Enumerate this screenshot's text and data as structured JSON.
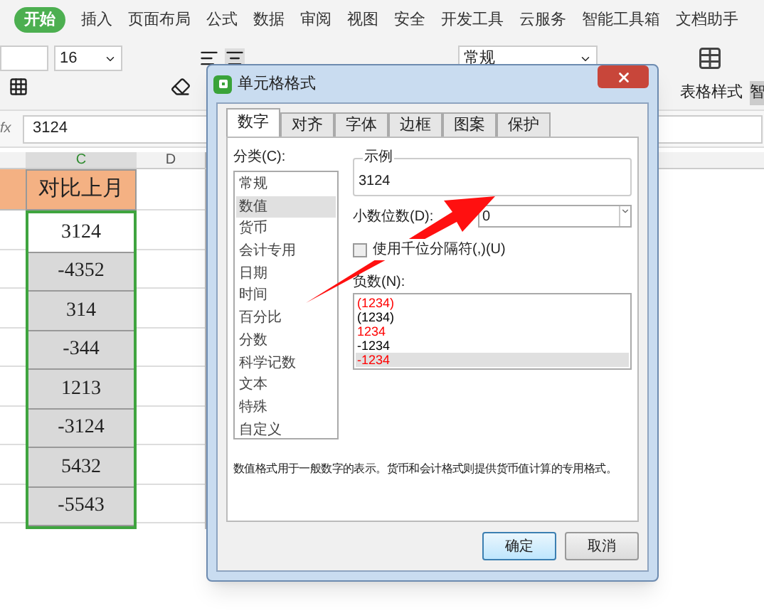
{
  "menu_tabs": [
    {
      "label": "开始",
      "selected": true
    },
    {
      "label": "插入",
      "selected": false
    },
    {
      "label": "页面布局",
      "selected": false
    },
    {
      "label": "公式",
      "selected": false
    },
    {
      "label": "数据",
      "selected": false
    },
    {
      "label": "审阅",
      "selected": false
    },
    {
      "label": "视图",
      "selected": false
    },
    {
      "label": "安全",
      "selected": false
    },
    {
      "label": "开发工具",
      "selected": false
    },
    {
      "label": "云服务",
      "selected": false
    },
    {
      "label": "智能工具箱",
      "selected": false
    },
    {
      "label": "文档助手",
      "selected": false
    }
  ],
  "toolbar": {
    "font_size": "16",
    "number_format": "常规",
    "table_style": "表格样式",
    "cut_label": "智"
  },
  "formula_bar": {
    "fx": "fx",
    "value": "3124"
  },
  "sheet": {
    "columns": [
      {
        "label": "C",
        "selected": true
      },
      {
        "label": "D",
        "selected": false
      }
    ],
    "header": "对比上月",
    "cells": [
      {
        "value": "3124",
        "active": true
      },
      {
        "value": "-4352",
        "active": false
      },
      {
        "value": "314",
        "active": false
      },
      {
        "value": "-344",
        "active": false
      },
      {
        "value": "1213",
        "active": false
      },
      {
        "value": "-3124",
        "active": false
      },
      {
        "value": "5432",
        "active": false
      },
      {
        "value": "-5543",
        "active": false
      }
    ]
  },
  "dialog": {
    "title": "单元格格式",
    "tabs": [
      {
        "label": "数字",
        "selected": true
      },
      {
        "label": "对齐",
        "selected": false
      },
      {
        "label": "字体",
        "selected": false
      },
      {
        "label": "边框",
        "selected": false
      },
      {
        "label": "图案",
        "selected": false
      },
      {
        "label": "保护",
        "selected": false
      }
    ],
    "category_label": "分类(C):",
    "categories": [
      {
        "label": "常规",
        "selected": false
      },
      {
        "label": "数值",
        "selected": true
      },
      {
        "label": "货币",
        "selected": false
      },
      {
        "label": "会计专用",
        "selected": false
      },
      {
        "label": "日期",
        "selected": false
      },
      {
        "label": "时间",
        "selected": false
      },
      {
        "label": "百分比",
        "selected": false
      },
      {
        "label": "分数",
        "selected": false
      },
      {
        "label": "科学记数",
        "selected": false
      },
      {
        "label": "文本",
        "selected": false
      },
      {
        "label": "特殊",
        "selected": false
      },
      {
        "label": "自定义",
        "selected": false
      }
    ],
    "sample_label": "示例",
    "sample_value": "3124",
    "decimal_label": "小数位数(D):",
    "decimal_value": "0",
    "thousands": {
      "label": "使用千位分隔符(,)(U)",
      "checked": false
    },
    "negative_label": "负数(N):",
    "negatives": [
      {
        "label": "(1234)",
        "color": "#ff0000",
        "selected": false
      },
      {
        "label": "(1234)",
        "color": "#000000",
        "selected": false
      },
      {
        "label": "1234",
        "color": "#ff0000",
        "selected": false
      },
      {
        "label": "-1234",
        "color": "#000000",
        "selected": false
      },
      {
        "label": "-1234",
        "color": "#ff0000",
        "selected": true
      }
    ],
    "description": "数值格式用于一般数字的表示。货币和会计格式则提供货币值计算的专用格式。",
    "buttons": [
      {
        "label": "确定",
        "default": true
      },
      {
        "label": "取消",
        "default": false
      }
    ]
  }
}
